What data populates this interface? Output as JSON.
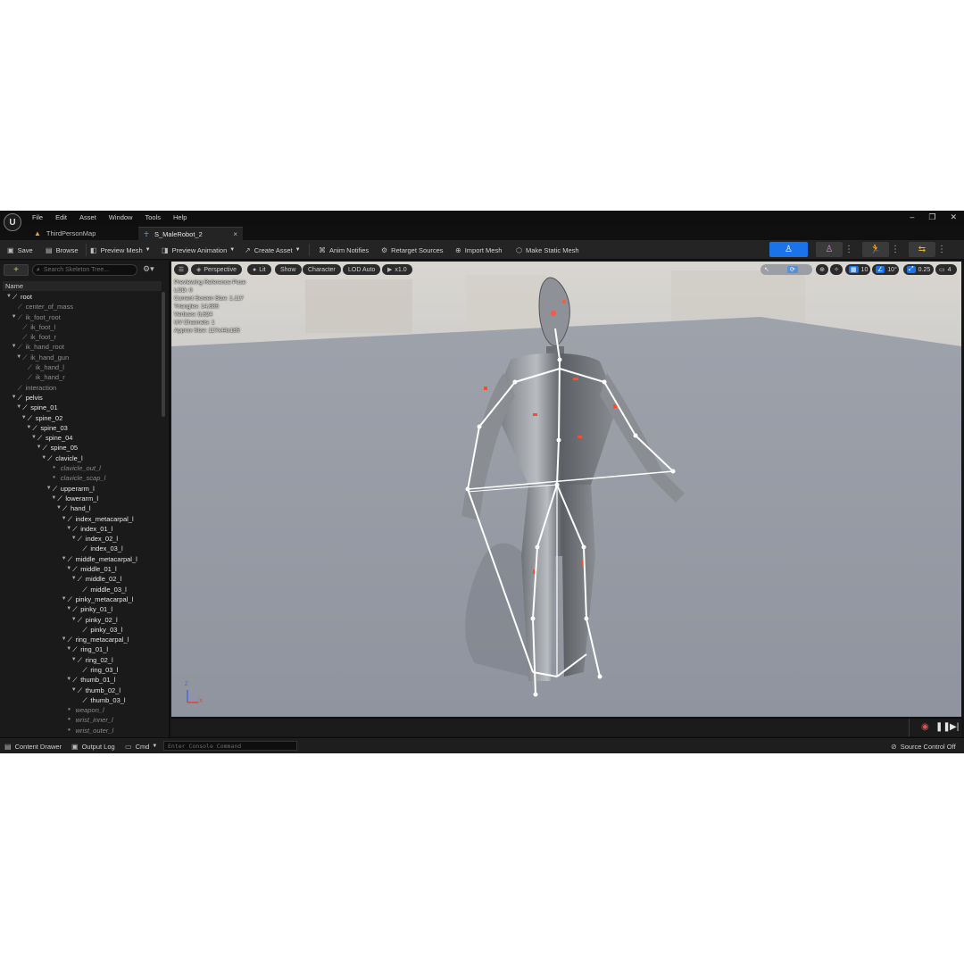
{
  "menu": {
    "logo": "U",
    "items": [
      "File",
      "Edit",
      "Asset",
      "Window",
      "Tools",
      "Help"
    ]
  },
  "window_controls": {
    "minimize": "–",
    "restore": "❐",
    "close": "✕"
  },
  "tabs": [
    {
      "label": "ThirdPersonMap",
      "icon": "level-icon"
    },
    {
      "label": "S_MaleRobot_2",
      "icon": "skeleton-icon",
      "close": "×"
    }
  ],
  "toolbar": {
    "save": "Save",
    "browse": "Browse",
    "preview_mesh": "Preview Mesh",
    "preview_animation": "Preview Animation",
    "create_asset": "Create Asset",
    "anim_notifies": "Anim Notifies",
    "retarget_sources": "Retarget Sources",
    "import_mesh": "Import Mesh",
    "make_static_mesh": "Make Static Mesh",
    "accent_color": "#1a73e8"
  },
  "skeleton_tree": {
    "search_placeholder": "Search Skeleton Tree...",
    "column_name": "Name",
    "rows": [
      {
        "label": "root",
        "depth": 0,
        "kind": "bone",
        "expanded": true
      },
      {
        "label": "center_of_mass",
        "depth": 1,
        "kind": "dim",
        "expanded": false
      },
      {
        "label": "ik_foot_root",
        "depth": 1,
        "kind": "dim",
        "expanded": true
      },
      {
        "label": "ik_foot_l",
        "depth": 2,
        "kind": "dim",
        "expanded": false
      },
      {
        "label": "ik_foot_r",
        "depth": 2,
        "kind": "dim",
        "expanded": false
      },
      {
        "label": "ik_hand_root",
        "depth": 1,
        "kind": "dim",
        "expanded": true
      },
      {
        "label": "ik_hand_gun",
        "depth": 2,
        "kind": "dim",
        "expanded": true
      },
      {
        "label": "ik_hand_l",
        "depth": 3,
        "kind": "dim",
        "expanded": false
      },
      {
        "label": "ik_hand_r",
        "depth": 3,
        "kind": "dim",
        "expanded": false
      },
      {
        "label": "interaction",
        "depth": 1,
        "kind": "dim",
        "expanded": false
      },
      {
        "label": "pelvis",
        "depth": 1,
        "kind": "bone",
        "expanded": true
      },
      {
        "label": "spine_01",
        "depth": 2,
        "kind": "bone",
        "expanded": true
      },
      {
        "label": "spine_02",
        "depth": 3,
        "kind": "bone",
        "expanded": true
      },
      {
        "label": "spine_03",
        "depth": 4,
        "kind": "bone",
        "expanded": true
      },
      {
        "label": "spine_04",
        "depth": 5,
        "kind": "bone",
        "expanded": true
      },
      {
        "label": "spine_05",
        "depth": 6,
        "kind": "bone",
        "expanded": true
      },
      {
        "label": "clavicle_l",
        "depth": 7,
        "kind": "bone",
        "expanded": true
      },
      {
        "label": "clavicle_out_l",
        "depth": 8,
        "kind": "socket",
        "expanded": false
      },
      {
        "label": "clavicle_scap_l",
        "depth": 8,
        "kind": "socket",
        "expanded": false
      },
      {
        "label": "upperarm_l",
        "depth": 8,
        "kind": "bone",
        "expanded": true
      },
      {
        "label": "lowerarm_l",
        "depth": 9,
        "kind": "bone",
        "expanded": true
      },
      {
        "label": "hand_l",
        "depth": 10,
        "kind": "bone",
        "expanded": true
      },
      {
        "label": "index_metacarpal_l",
        "depth": 11,
        "kind": "bone",
        "expanded": true
      },
      {
        "label": "index_01_l",
        "depth": 12,
        "kind": "bone",
        "expanded": true
      },
      {
        "label": "index_02_l",
        "depth": 13,
        "kind": "bone",
        "expanded": true
      },
      {
        "label": "index_03_l",
        "depth": 14,
        "kind": "bone",
        "expanded": false
      },
      {
        "label": "middle_metacarpal_l",
        "depth": 11,
        "kind": "bone",
        "expanded": true
      },
      {
        "label": "middle_01_l",
        "depth": 12,
        "kind": "bone",
        "expanded": true
      },
      {
        "label": "middle_02_l",
        "depth": 13,
        "kind": "bone",
        "expanded": true
      },
      {
        "label": "middle_03_l",
        "depth": 14,
        "kind": "bone",
        "expanded": false
      },
      {
        "label": "pinky_metacarpal_l",
        "depth": 11,
        "kind": "bone",
        "expanded": true
      },
      {
        "label": "pinky_01_l",
        "depth": 12,
        "kind": "bone",
        "expanded": true
      },
      {
        "label": "pinky_02_l",
        "depth": 13,
        "kind": "bone",
        "expanded": true
      },
      {
        "label": "pinky_03_l",
        "depth": 14,
        "kind": "bone",
        "expanded": false
      },
      {
        "label": "ring_metacarpal_l",
        "depth": 11,
        "kind": "bone",
        "expanded": true
      },
      {
        "label": "ring_01_l",
        "depth": 12,
        "kind": "bone",
        "expanded": true
      },
      {
        "label": "ring_02_l",
        "depth": 13,
        "kind": "bone",
        "expanded": true
      },
      {
        "label": "ring_03_l",
        "depth": 14,
        "kind": "bone",
        "expanded": false
      },
      {
        "label": "thumb_01_l",
        "depth": 12,
        "kind": "bone",
        "expanded": true
      },
      {
        "label": "thumb_02_l",
        "depth": 13,
        "kind": "bone",
        "expanded": true
      },
      {
        "label": "thumb_03_l",
        "depth": 14,
        "kind": "bone",
        "expanded": false
      },
      {
        "label": "weapon_l",
        "depth": 11,
        "kind": "socket",
        "expanded": false
      },
      {
        "label": "wrist_inner_l",
        "depth": 11,
        "kind": "socket",
        "expanded": false
      },
      {
        "label": "wrist_outer_l",
        "depth": 11,
        "kind": "socket",
        "expanded": false
      }
    ]
  },
  "viewport": {
    "perspective": "Perspective",
    "lit": "Lit",
    "show": "Show",
    "character": "Character",
    "lod": "LOD Auto",
    "play_rate": "x1.0",
    "grid_snap": "10",
    "rotation_snap": "10°",
    "scale_snap": "0.25",
    "camera_speed": "4",
    "stats": [
      "Previewing Reference Pose",
      "LOD: 0",
      "Current Screen Size: 1.117",
      "Triangles: 14,686",
      "Vertices: 8,624",
      "UV Channels: 1",
      "Approx Size: 117x44x185"
    ],
    "axis": {
      "x": "X",
      "z": "Z"
    }
  },
  "status": {
    "content_drawer": "Content Drawer",
    "output_log": "Output Log",
    "cmd": "Cmd",
    "console_placeholder": "Enter Console Command",
    "source_control": "Source Control Off"
  }
}
